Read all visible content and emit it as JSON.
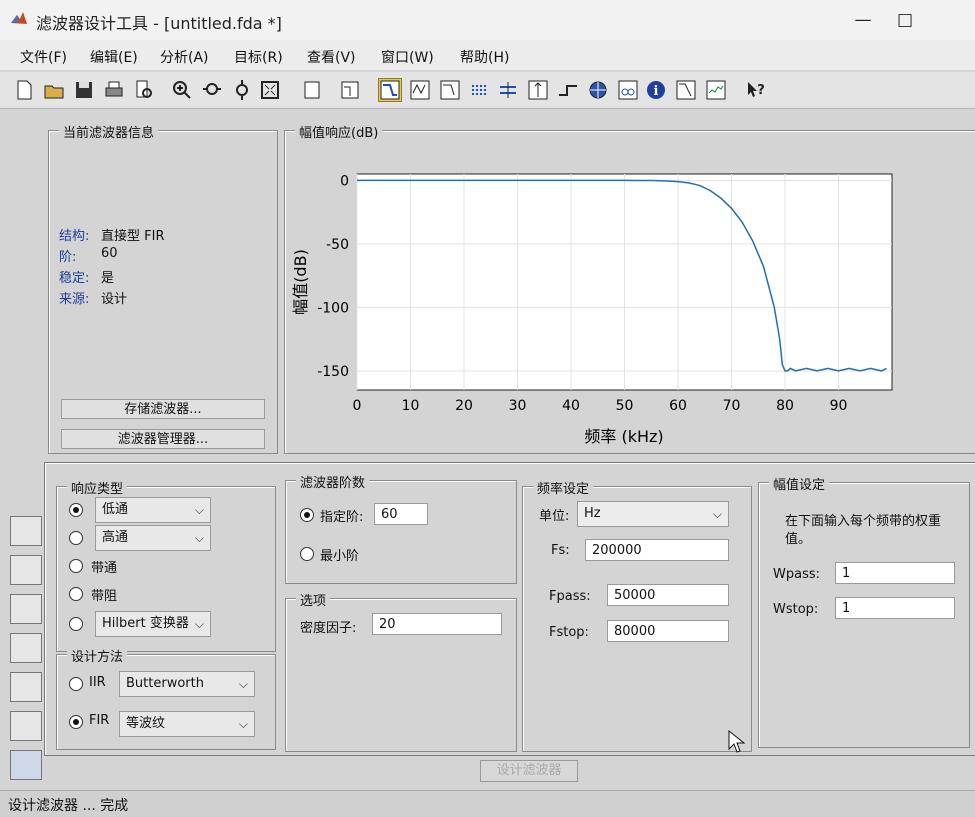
{
  "window": {
    "title": "滤波器设计工具 - [untitled.fda *]",
    "min": "—",
    "max": "□"
  },
  "menu": [
    "文件(F)",
    "编辑(E)",
    "分析(A)",
    "目标(R)",
    "查看(V)",
    "窗口(W)",
    "帮助(H)"
  ],
  "info": {
    "group_title": "当前滤波器信息",
    "rows": [
      {
        "key": "结构:",
        "value": "直接型 FIR"
      },
      {
        "key": "阶:",
        "value": "60"
      },
      {
        "key": "稳定:",
        "value": "是"
      },
      {
        "key": "来源:",
        "value": "设计"
      }
    ],
    "store_button": "存储滤波器...",
    "manager_button": "滤波器管理器..."
  },
  "plot": {
    "group_title": "幅值响应(dB)"
  },
  "chart_data": {
    "type": "line",
    "xlabel": "频率 (kHz)",
    "ylabel": "幅值(dB)",
    "xlim": [
      0,
      100
    ],
    "ylim": [
      -165,
      5
    ],
    "xticks": [
      0,
      10,
      20,
      30,
      40,
      50,
      60,
      70,
      80,
      90
    ],
    "yticks": [
      0,
      -50,
      -100,
      -150
    ],
    "grid": true,
    "series": [
      {
        "x": [
          0,
          10,
          20,
          30,
          40,
          50,
          55,
          58,
          60,
          62,
          64,
          66,
          68,
          70,
          72,
          74,
          76,
          78,
          79,
          79.5,
          80,
          80.5,
          81,
          82,
          84,
          86,
          88,
          90,
          92,
          94,
          96,
          98,
          99
        ],
        "y": [
          0,
          0,
          0,
          0,
          0,
          0,
          -0.1,
          -0.5,
          -1,
          -2,
          -4,
          -8,
          -14,
          -22,
          -33,
          -48,
          -68,
          -100,
          -125,
          -145,
          -150,
          -150,
          -148,
          -150,
          -148,
          -150,
          -148,
          -150,
          -148,
          -150,
          -148,
          -150,
          -148
        ]
      }
    ],
    "line_color": "#1f6fb5"
  },
  "response_type": {
    "group_title": "响应类型",
    "options": [
      {
        "label": "低通",
        "combo": "低通",
        "selected": true
      },
      {
        "label": "",
        "combo": "高通",
        "selected": false
      },
      {
        "label": "带通",
        "selected": false
      },
      {
        "label": "带阻",
        "selected": false
      },
      {
        "label": "",
        "combo": "Hilbert 变换器",
        "selected": false
      }
    ]
  },
  "design_method": {
    "group_title": "设计方法",
    "iir_label": "IIR",
    "iir_combo": "Butterworth",
    "fir_label": "FIR",
    "fir_combo": "等波纹",
    "fir_selected": true
  },
  "filter_order": {
    "group_title": "滤波器阶数",
    "specify_label": "指定阶:",
    "specify_value": "60",
    "min_label": "最小阶"
  },
  "options": {
    "group_title": "选项",
    "density_label": "密度因子:",
    "density_value": "20"
  },
  "freq": {
    "group_title": "频率设定",
    "units_label": "单位:",
    "units_value": "Hz",
    "fs_label": "Fs:",
    "fs_value": "200000",
    "fpass_label": "Fpass:",
    "fpass_value": "50000",
    "fstop_label": "Fstop:",
    "fstop_value": "80000"
  },
  "mag": {
    "group_title": "幅值设定",
    "desc": "在下面输入每个频带的权重值。",
    "wpass_label": "Wpass:",
    "wpass_value": "1",
    "wstop_label": "Wstop:",
    "wstop_value": "1"
  },
  "design_button": "设计滤波器",
  "status": "设计滤波器 ... 完成"
}
